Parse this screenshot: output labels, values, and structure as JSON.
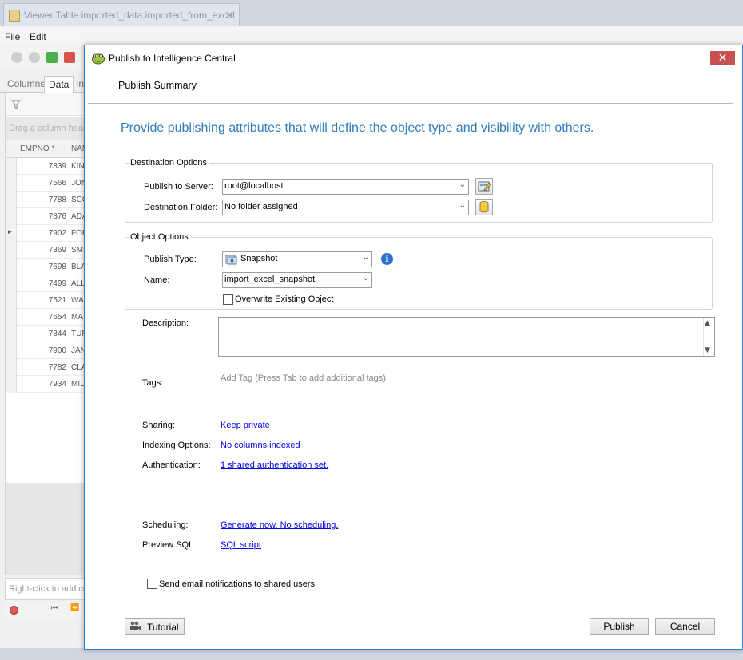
{
  "app": {
    "doc_tab_title": "Viewer Table imported_data.imported_from_excel",
    "menu": {
      "file": "File",
      "edit": "Edit"
    },
    "viewer_tabs": [
      "Columns",
      "Data",
      "In"
    ],
    "group_hint": "Drag a column heade",
    "columns": [
      "EMPNO *",
      "NAM"
    ],
    "rows": [
      {
        "empno": "7839",
        "name": "KIN"
      },
      {
        "empno": "7566",
        "name": "JON"
      },
      {
        "empno": "7788",
        "name": "SCO"
      },
      {
        "empno": "7876",
        "name": "ADA"
      },
      {
        "empno": "7902",
        "name": "FOR"
      },
      {
        "empno": "7369",
        "name": "SMI"
      },
      {
        "empno": "7698",
        "name": "BLA"
      },
      {
        "empno": "7499",
        "name": "ALL"
      },
      {
        "empno": "7521",
        "name": "WA"
      },
      {
        "empno": "7654",
        "name": "MA"
      },
      {
        "empno": "7844",
        "name": "TUF"
      },
      {
        "empno": "7900",
        "name": "JAN"
      },
      {
        "empno": "7782",
        "name": "CLA"
      },
      {
        "empno": "7934",
        "name": "MIL"
      }
    ],
    "status_hint": "Right-click to add co"
  },
  "dialog": {
    "title": "Publish to Intelligence Central",
    "close_glyph": "✕",
    "page_header": "Publish Summary",
    "intro": "Provide publishing attributes that will define the object type and visibility with others.",
    "destination": {
      "legend": "Destination Options",
      "server_label": "Publish to Server:",
      "server_value": "root@localhost",
      "folder_label": "Destination Folder:",
      "folder_value": "No folder assigned"
    },
    "object": {
      "legend": "Object Options",
      "type_label": "Publish Type:",
      "type_value": "Snapshot",
      "name_label": "Name:",
      "name_value": "import_excel_snapshot",
      "overwrite_label": "Overwrite Existing Object"
    },
    "description_label": "Description:",
    "tags_label": "Tags:",
    "tags_placeholder": "Add Tag (Press Tab to add additional tags)",
    "sharing_label": "Sharing:",
    "sharing_link": "Keep private",
    "indexing_label": "Indexing Options:",
    "indexing_link": "No columns indexed",
    "auth_label": "Authentication:",
    "auth_link": "1 shared authentication set.",
    "scheduling_label": "Scheduling:",
    "scheduling_link": "Generate now. No scheduling.",
    "preview_label": "Preview SQL:",
    "preview_link": "SQL script",
    "email_label": "Send email notifications to shared users",
    "buttons": {
      "tutorial": "Tutorial",
      "publish": "Publish",
      "cancel": "Cancel"
    }
  },
  "colors": {
    "accent_blue": "#2e7cbf",
    "link": "#0000ee",
    "close_red": "#c75050",
    "dialog_border": "#2f7ed0"
  }
}
